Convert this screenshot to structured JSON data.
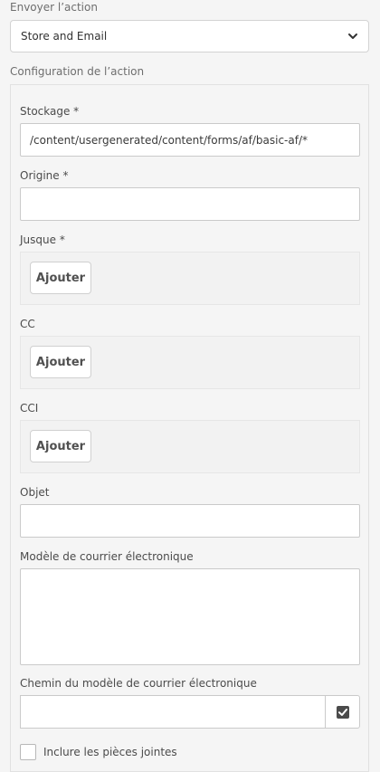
{
  "submit_action": {
    "label": "Envoyer l’action",
    "selected": "Store and Email"
  },
  "action_config": {
    "title": "Configuration de l’action",
    "storage": {
      "label": "Stockage *",
      "value": "/content/usergenerated/content/forms/af/basic-af/*"
    },
    "from": {
      "label": "Origine *",
      "value": ""
    },
    "to": {
      "label": "Jusque *",
      "add_label": "Ajouter"
    },
    "cc": {
      "label": "CC",
      "add_label": "Ajouter"
    },
    "bcc": {
      "label": "CCI",
      "add_label": "Ajouter"
    },
    "subject": {
      "label": "Objet",
      "value": ""
    },
    "email_template": {
      "label": "Modèle de courrier électronique",
      "value": ""
    },
    "email_template_path": {
      "label": "Chemin du modèle de courrier électronique",
      "value": ""
    },
    "include_attachments": {
      "label": "Inclure les pièces jointes",
      "checked": false
    }
  }
}
